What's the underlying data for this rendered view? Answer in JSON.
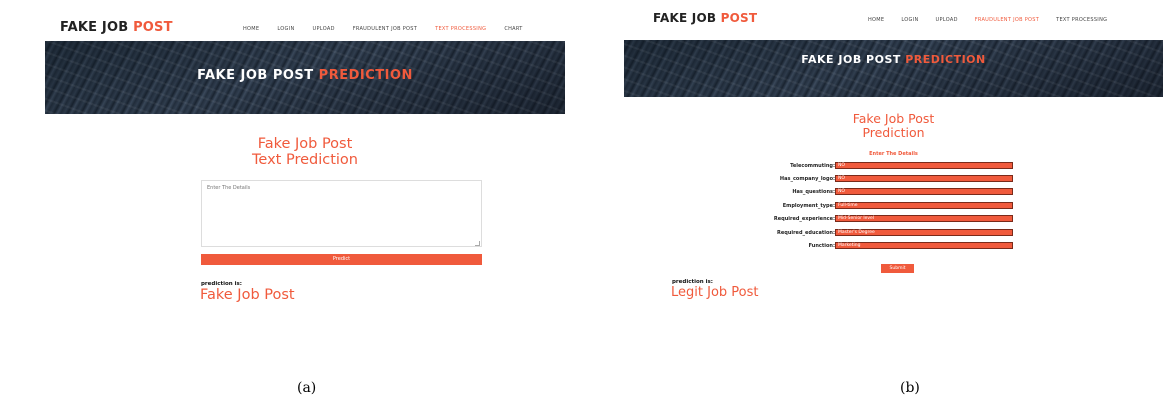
{
  "logo": {
    "main": "FAKE JOB ",
    "accent": "POST"
  },
  "panel_a": {
    "nav": [
      "HOME",
      "LOGIN",
      "UPLOAD",
      "FRAUDULENT JOB POST",
      "TEXT PROCESSING",
      "CHART"
    ],
    "nav_active_index": 4,
    "hero": {
      "main": "FAKE JOB POST ",
      "accent": "PREDICTION"
    },
    "title_line1": "Fake Job Post",
    "title_line2": "Text Prediction",
    "textarea_placeholder": "Enter The Details",
    "predict_label": "Predict",
    "prediction_label": "prediction is:",
    "prediction_value": "Fake Job Post"
  },
  "panel_b": {
    "nav": [
      "HOME",
      "LOGIN",
      "UPLOAD",
      "FRAUDULENT JOB POST",
      "TEXT PROCESSING"
    ],
    "nav_active_index": 3,
    "hero": {
      "main": "FAKE JOB POST ",
      "accent": "PREDICTION"
    },
    "title_line1": "Fake Job Post",
    "title_line2": "Prediction",
    "form_subtitle": "Enter The Details",
    "fields": [
      {
        "label": "Telecommuting:",
        "value": "NO"
      },
      {
        "label": "Has_company_logo:",
        "value": "NO"
      },
      {
        "label": "Has_questions:",
        "value": "NO"
      },
      {
        "label": "Employment_type:",
        "value": "Full-time"
      },
      {
        "label": "Required_experience:",
        "value": "Mid-Senior level"
      },
      {
        "label": "Required_education:",
        "value": "Master's Degree"
      },
      {
        "label": "Function:",
        "value": "Marketing"
      }
    ],
    "submit_label": "Submit",
    "prediction_label": "prediction is:",
    "prediction_value": "Legit Job Post"
  },
  "captions": {
    "a": "(a)",
    "b": "(b)"
  },
  "colors": {
    "accent": "#f05a3c",
    "hero_dark": "#2b3643"
  }
}
